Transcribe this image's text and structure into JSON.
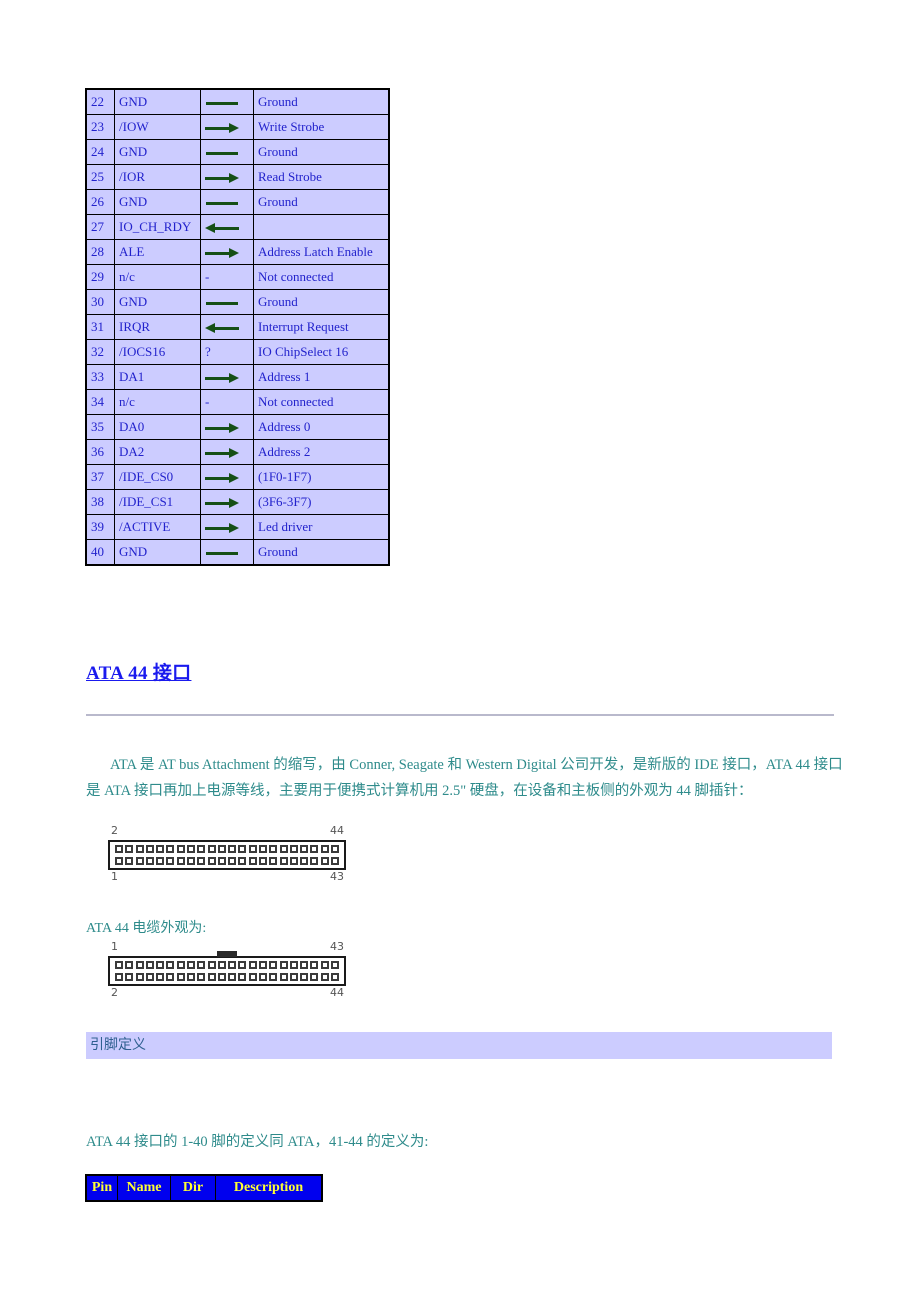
{
  "pin_table": {
    "columns": [
      "Pin",
      "Name",
      "Dir",
      "Description"
    ],
    "rows": [
      {
        "pin": "22",
        "name": "GND",
        "dir": "line",
        "desc": "Ground"
      },
      {
        "pin": "23",
        "name": "/IOW",
        "dir": "right",
        "desc": "Write Strobe"
      },
      {
        "pin": "24",
        "name": "GND",
        "dir": "line",
        "desc": "Ground"
      },
      {
        "pin": "25",
        "name": "/IOR",
        "dir": "right",
        "desc": "Read Strobe"
      },
      {
        "pin": "26",
        "name": "GND",
        "dir": "line",
        "desc": "Ground"
      },
      {
        "pin": "27",
        "name": "IO_CH_RDY",
        "dir": "left",
        "desc": ""
      },
      {
        "pin": "28",
        "name": "ALE",
        "dir": "right",
        "desc": "Address Latch Enable"
      },
      {
        "pin": "29",
        "name": "n/c",
        "dir": "-",
        "desc": "Not connected"
      },
      {
        "pin": "30",
        "name": "GND",
        "dir": "line",
        "desc": "Ground"
      },
      {
        "pin": "31",
        "name": "IRQR",
        "dir": "left",
        "desc": "Interrupt Request"
      },
      {
        "pin": "32",
        "name": "/IOCS16",
        "dir": "?",
        "desc": "IO ChipSelect 16"
      },
      {
        "pin": "33",
        "name": "DA1",
        "dir": "right",
        "desc": "Address 1"
      },
      {
        "pin": "34",
        "name": "n/c",
        "dir": "-",
        "desc": "Not connected"
      },
      {
        "pin": "35",
        "name": "DA0",
        "dir": "right",
        "desc": "Address 0"
      },
      {
        "pin": "36",
        "name": "DA2",
        "dir": "right",
        "desc": "Address 2"
      },
      {
        "pin": "37",
        "name": "/IDE_CS0",
        "dir": "right",
        "desc": "(1F0-1F7)"
      },
      {
        "pin": "38",
        "name": "/IDE_CS1",
        "dir": "right",
        "desc": "(3F6-3F7)"
      },
      {
        "pin": "39",
        "name": "/ACTIVE",
        "dir": "right",
        "desc": "Led driver"
      },
      {
        "pin": "40",
        "name": "GND",
        "dir": "line",
        "desc": "Ground"
      }
    ]
  },
  "section": {
    "heading": "ATA 44 接口",
    "paragraph": "ATA 是 AT bus Attachment 的缩写，由 Conner, Seagate 和 Western Digital 公司开发，是新版的 IDE 接口，ATA 44 接口是 ATA 接口再加上电源等线，主要用于便携式计算机用 2.5\" 硬盘，在设备和主板侧的外观为 44 脚插针："
  },
  "connector_device": {
    "top_left_label": "2",
    "top_right_label": "44",
    "bottom_left_label": "1",
    "bottom_right_label": "43",
    "pin_columns": 22,
    "has_notch": false
  },
  "cable_caption": "ATA 44 电缆外观为:",
  "connector_cable": {
    "top_left_label": "1",
    "top_right_label": "43",
    "bottom_left_label": "2",
    "bottom_right_label": "44",
    "pin_columns": 22,
    "has_notch": true
  },
  "subsection": {
    "bar_label": "引脚定义",
    "note": "ATA 44 接口的 1-40 脚的定义同 ATA，41-44 的定义为:"
  },
  "bottom_table": {
    "columns": [
      "Pin",
      "Name",
      "Dir",
      "Description"
    ]
  },
  "colors": {
    "table_bg": "#ccccff",
    "table_text": "#2222cc",
    "arrow": "#165016",
    "heading": "#1a1aee",
    "body_text": "#2e8b8b",
    "header_bg": "#0000ee",
    "header_text": "#ffff33"
  }
}
